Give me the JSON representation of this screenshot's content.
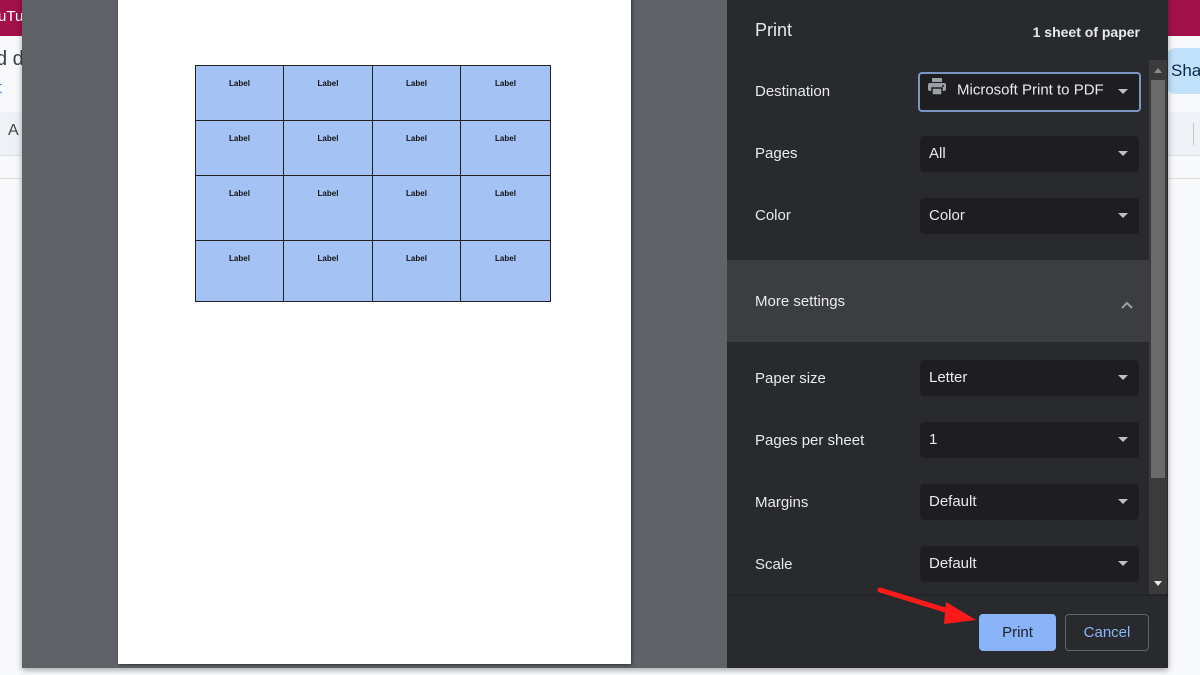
{
  "background_app": {
    "tab_fragment": "uTu",
    "line1_fragment": "d d",
    "line2_fragment": "t",
    "toolbar_fragment": "A",
    "share_fragment": "Sha"
  },
  "preview": {
    "label_sheet": {
      "rows": 4,
      "columns": 4,
      "cells": [
        [
          "Label",
          "Label",
          "Label",
          "Label"
        ],
        [
          "Label",
          "Label",
          "Label",
          "Label"
        ],
        [
          "Label",
          "Label",
          "Label",
          "Label"
        ],
        [
          "Label",
          "Label",
          "Label",
          "Label"
        ]
      ],
      "fill_color": "#a4c2f4"
    }
  },
  "print_panel": {
    "title": "Print",
    "sheet_count": "1 sheet of paper",
    "settings": [
      {
        "label": "Destination",
        "value": "Microsoft Print to PDF",
        "icon": "printer-icon"
      },
      {
        "label": "Pages",
        "value": "All"
      },
      {
        "label": "Color",
        "value": "Color"
      }
    ],
    "more_settings": {
      "label": "More settings",
      "expanded": true
    },
    "more": [
      {
        "label": "Paper size",
        "value": "Letter"
      },
      {
        "label": "Pages per sheet",
        "value": "1"
      },
      {
        "label": "Margins",
        "value": "Default"
      },
      {
        "label": "Scale",
        "value": "Default"
      }
    ],
    "buttons": {
      "print": "Print",
      "cancel": "Cancel"
    },
    "accent_color": "#8ab4f8"
  },
  "annotation": {
    "type": "arrow",
    "color": "#ff0000",
    "points_to": "print-button"
  }
}
